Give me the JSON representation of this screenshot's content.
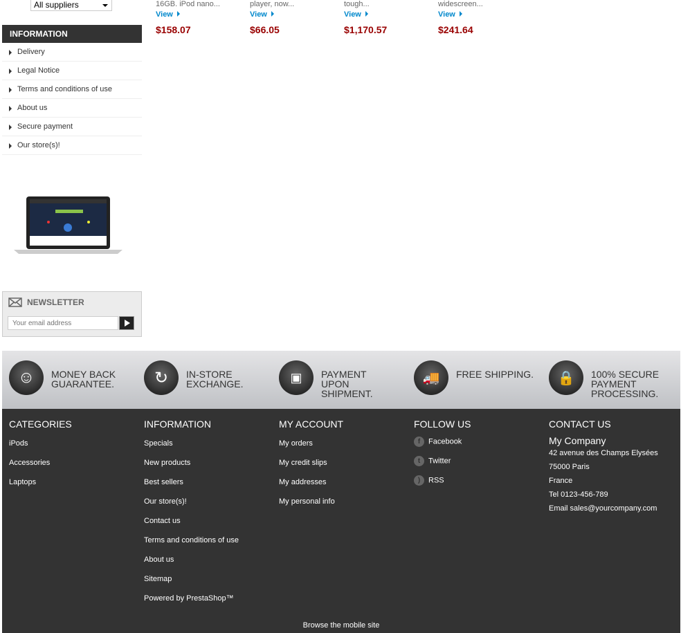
{
  "suppliers_select": {
    "value": "All suppliers"
  },
  "products": [
    {
      "desc": "16GB. iPod nano...",
      "view": "View",
      "price": "$158.07"
    },
    {
      "desc": "player, now...",
      "view": "View",
      "price": "$66.05"
    },
    {
      "desc": "tough...",
      "view": "View",
      "price": "$1,170.57"
    },
    {
      "desc": "widescreen...",
      "view": "View",
      "price": "$241.64"
    }
  ],
  "information": {
    "title": "INFORMATION",
    "items": [
      "Delivery",
      "Legal Notice",
      "Terms and conditions of use",
      "About us",
      "Secure payment",
      "Our store(s)!"
    ]
  },
  "newsletter": {
    "title": "NEWSLETTER",
    "placeholder": "Your email address"
  },
  "reassurance": [
    "MONEY BACK\nGUARANTEE.",
    "IN-STORE\nEXCHANGE.",
    "PAYMENT UPON\nSHIPMENT.",
    "FREE SHIPPING.",
    "100% SECURE\nPAYMENT\nPROCESSING."
  ],
  "footer": {
    "categories": {
      "title": "CATEGORIES",
      "items": [
        "iPods",
        "Accessories",
        "Laptops"
      ]
    },
    "information": {
      "title": "INFORMATION",
      "items": [
        "Specials",
        "New products",
        "Best sellers",
        "Our store(s)!",
        "Contact us",
        "Terms and conditions of use",
        "About us",
        "Sitemap",
        "Powered by PrestaShop™"
      ]
    },
    "account": {
      "title": "MY ACCOUNT",
      "items": [
        "My orders",
        "My credit slips",
        "My addresses",
        "My personal info"
      ]
    },
    "follow": {
      "title": "FOLLOW US",
      "items": [
        "Facebook",
        "Twitter",
        "RSS"
      ]
    },
    "contact": {
      "title": "CONTACT US",
      "company": "My Company",
      "lines": [
        "42 avenue des Champs Elysées",
        "75000 Paris",
        "France",
        "Tel 0123-456-789",
        "Email sales@yourcompany.com"
      ]
    },
    "mobile": "Browse the mobile site"
  }
}
